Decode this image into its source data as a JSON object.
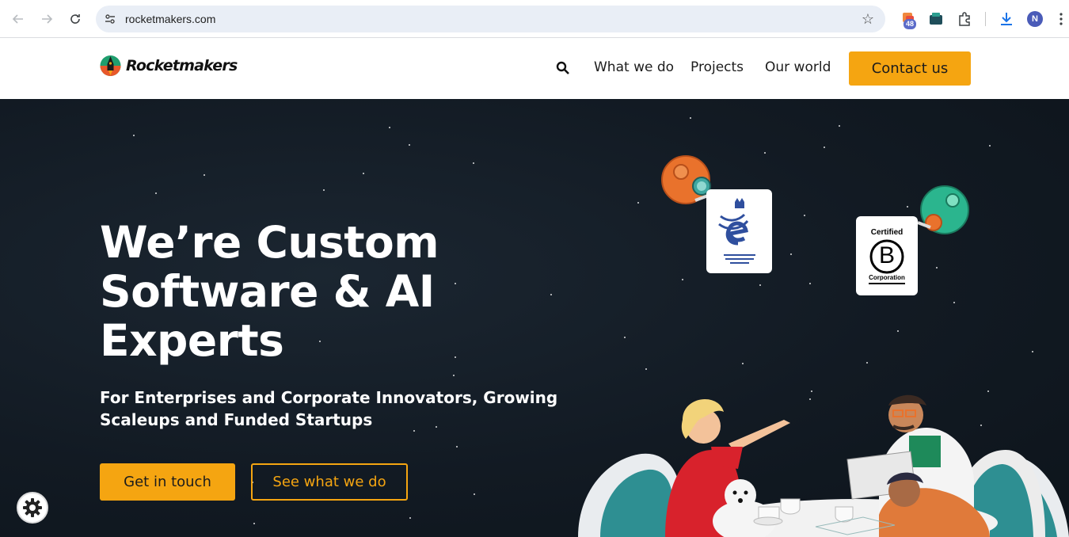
{
  "browser": {
    "url": "rocketmakers.com",
    "extension_badge": "48",
    "profile_initial": "N"
  },
  "header": {
    "brand": "Rocketmakers",
    "menu": [
      "What we do",
      "Projects",
      "Our world"
    ],
    "contact_label": "Contact us"
  },
  "hero": {
    "title_lines": [
      "We’re Custom",
      "Software & AI",
      "Experts"
    ],
    "subtitle": "For Enterprises and Corporate Innovators, Growing Scaleups and Funded Startups",
    "primary_cta": "Get in touch",
    "secondary_cta": "See what we do"
  },
  "badges": {
    "bcorp_top": "Certified",
    "bcorp_letter": "B",
    "bcorp_bottom": "Corporation"
  },
  "colors": {
    "accent": "#f5a511",
    "hero_bg": "#121a23",
    "header_bg": "#ffffff"
  }
}
